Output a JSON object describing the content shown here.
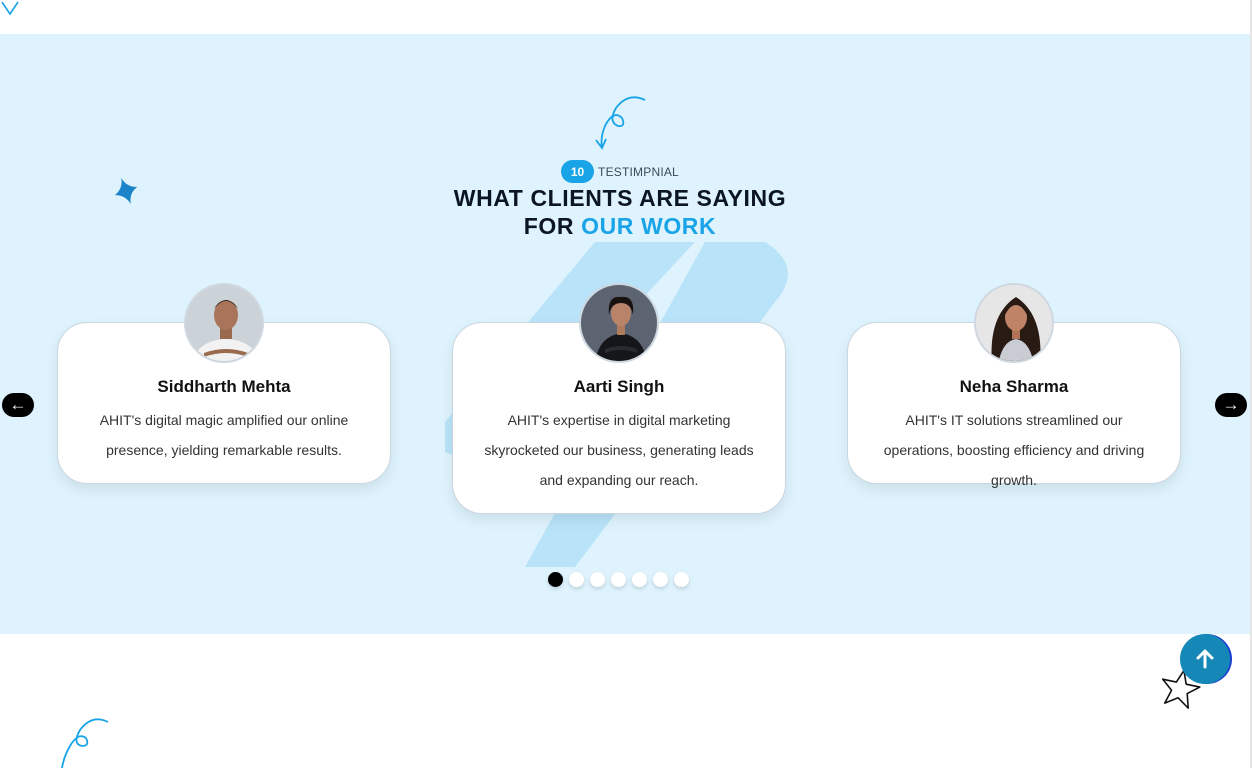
{
  "header": {
    "badge_number": "10",
    "badge_label": "TESTIMPNIAL",
    "title_line1": "WHAT CLIENTS ARE SAYING",
    "title_line2_prefix": "FOR ",
    "title_line2_accent": "OUR WORK"
  },
  "testimonials": [
    {
      "name": "Siddharth Mehta",
      "text": "AHIT's digital magic amplified our online presence, yielding remarkable results."
    },
    {
      "name": "Aarti Singh",
      "text": "AHIT's expertise in digital marketing skyrocketed our business, generating leads and expanding our reach."
    },
    {
      "name": "Neha Sharma",
      "text": "AHIT's IT solutions streamlined our operations, boosting efficiency and driving growth."
    }
  ],
  "navigation": {
    "prev_symbol": "←",
    "next_symbol": "→"
  },
  "pagination": {
    "total": 7,
    "active_index": 0
  },
  "icons": {
    "prev": "arrow-left-icon",
    "next": "arrow-right-icon",
    "scroll_top": "arrow-up-icon",
    "decorative": [
      "curly-arrow-icon",
      "sparkle-star-icon",
      "outline-star-icon"
    ]
  },
  "colors": {
    "accent": "#1aa4e8",
    "section_bg": "#def3fd",
    "scroll_button": "#1588b8"
  }
}
